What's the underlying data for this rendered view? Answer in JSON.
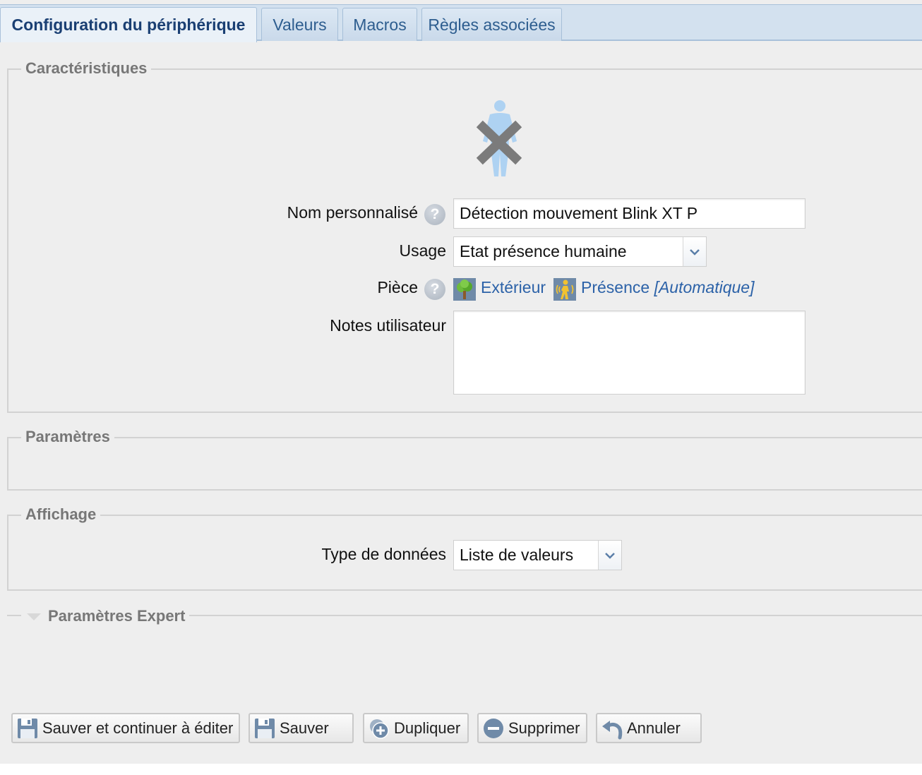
{
  "tabs": [
    {
      "label": "Configuration du périphérique",
      "active": true
    },
    {
      "label": "Valeurs"
    },
    {
      "label": "Macros"
    },
    {
      "label": "Règles associées"
    }
  ],
  "sections": {
    "caracteristiques": "Caractéristiques",
    "parametres": "Paramètres",
    "affichage": "Affichage",
    "expert": "Paramètres Expert"
  },
  "form": {
    "name_label": "Nom personnalisé",
    "name_value": "Détection mouvement Blink XT P",
    "usage_label": "Usage",
    "usage_value": "Etat présence humaine",
    "room_label": "Pièce",
    "room_value": "Extérieur",
    "category_value": "Présence",
    "category_suffix": "[Automatique]",
    "notes_label": "Notes utilisateur",
    "notes_value": "",
    "datatype_label": "Type de données",
    "datatype_value": "Liste de valeurs",
    "help_glyph": "?"
  },
  "icons": {
    "device": "human-presence-disabled-icon",
    "room": "tree-icon",
    "category": "motion-presence-icon"
  },
  "buttons": {
    "save_continue": "Sauver et continuer à éditer",
    "save": "Sauver",
    "duplicate": "Dupliquer",
    "delete": "Supprimer",
    "cancel": "Annuler"
  },
  "colors": {
    "tab_bar": "#d3e1ef",
    "tab_active_text": "#1a3f73",
    "tab_text": "#2d5d8f",
    "link": "#2c62a8",
    "background": "#eeeeee"
  }
}
